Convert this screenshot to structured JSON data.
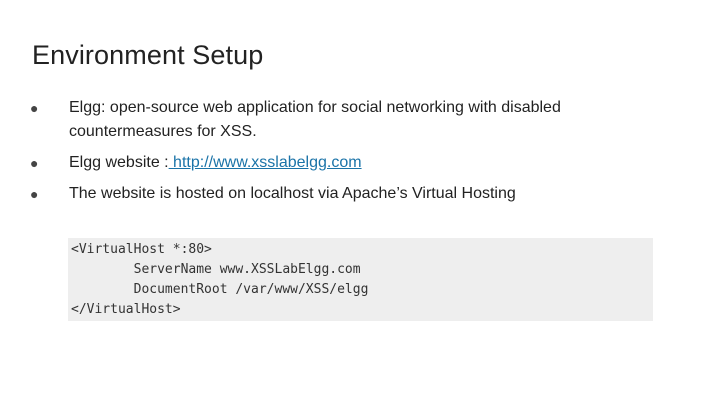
{
  "title": "Environment Setup",
  "bullets": [
    {
      "text": "Elgg: open-source web application for social networking with disabled countermeasures for XSS."
    },
    {
      "prefix": "Elgg website :",
      "link": " http://www.xsslabelgg.com"
    },
    {
      "text": "The website is hosted on localhost via Apache’s Virtual Hosting"
    }
  ],
  "bullet_glyph": "●",
  "code": [
    "<VirtualHost *:80>",
    "        ServerName www.XSSLabElgg.com",
    "        DocumentRoot /var/www/XSS/elgg",
    "</VirtualHost>"
  ],
  "colors": {
    "link": "#1a73a8",
    "code_bg": "#eeeeee",
    "text": "#222222"
  }
}
